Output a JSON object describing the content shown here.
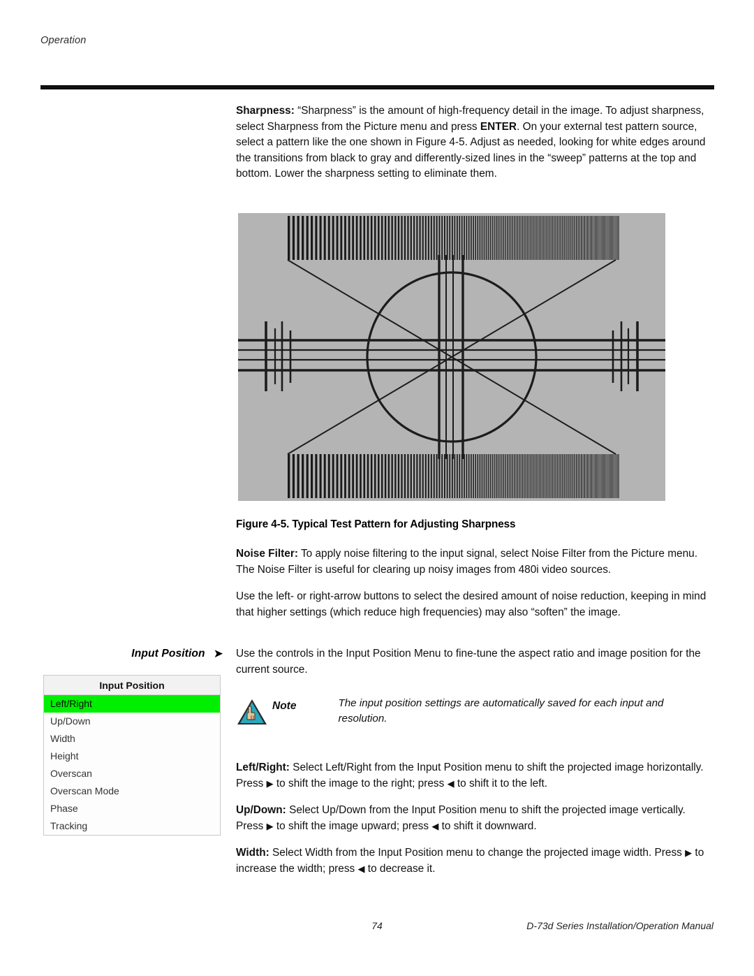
{
  "header": {
    "running_head": "Operation"
  },
  "body": {
    "sharpness_label": "Sharpness:",
    "sharpness_text_1": " “Sharpness” is the amount of high-frequency detail in the image. To adjust sharpness, select Sharpness from the Picture menu and press ",
    "enter_key": "ENTER",
    "sharpness_text_2": ". On your external test pattern source, select a pattern like the one shown in Figure 4-5. Adjust as needed, looking for white edges around the transitions from black to gray and differently-sized lines in the “sweep” patterns at the top and bottom. Lower the sharpness setting to eliminate them."
  },
  "figure": {
    "caption": "Figure 4-5. Typical Test Pattern for Adjusting Sharpness",
    "background_color": "#b4b4b4",
    "line_color": "#1a1a1a"
  },
  "noise_filter": {
    "label": "Noise Filter:",
    "text": " To apply noise filtering to the input signal, select Noise Filter from the Picture menu. The Noise Filter is useful for clearing up noisy images from 480i video sources.",
    "paragraph2": "Use the left- or right-arrow buttons to select the desired amount of noise reduction, keeping in mind that higher settings (which reduce high frequencies) may also “soften” the image."
  },
  "input_position": {
    "margin_heading": "Input Position",
    "margin_arrow": "➤",
    "intro": "Use the controls in the Input Position Menu to fine-tune the aspect ratio and image position for the current source.",
    "menu": {
      "title": "Input Position",
      "selected_index": 0,
      "highlight_color": "#00ef00",
      "items": [
        "Left/Right",
        "Up/Down",
        "Width",
        "Height",
        "Overscan",
        "Overscan Mode",
        "Phase",
        "Tracking"
      ]
    }
  },
  "note": {
    "icon_name": "note-triangle-hand-icon",
    "label": "Note",
    "text": "The input position settings are automatically saved for each input and resolution."
  },
  "settings": {
    "left_right_label": "Left/Right:",
    "left_right_a": " Select Left/Right from the Input Position menu to shift the projected image horizontally. Press ",
    "left_right_b": " to shift the image to the right; press ",
    "left_right_c": " to shift it to the left.",
    "up_down_label": "Up/Down:",
    "up_down_a": " Select Up/Down from the Input Position menu to shift the projected image vertically. Press ",
    "up_down_b": " to shift the image upward; press ",
    "up_down_c": " to shift it downward.",
    "width_label": "Width:",
    "width_a": " Select Width from the Input Position menu to change the projected image width. Press ",
    "width_b": " to increase the width; press ",
    "width_c": " to decrease it.",
    "arrow_right": "▶",
    "arrow_left": "◀"
  },
  "footer": {
    "page_number": "74",
    "manual_title": "D-73d Series Installation/Operation Manual"
  }
}
